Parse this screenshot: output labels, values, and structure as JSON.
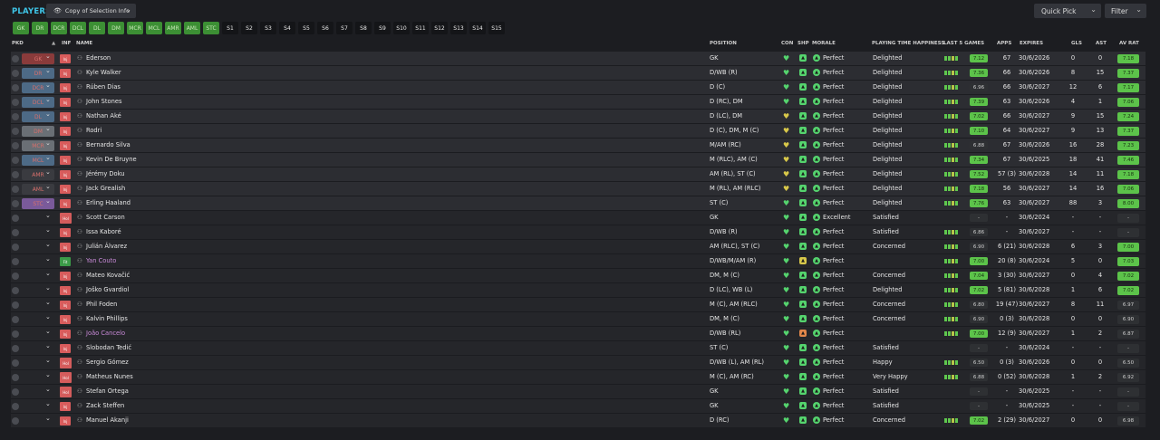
{
  "header": {
    "title": "PLAYERS",
    "view_label": "Copy of Selection Info",
    "quick_pick_label": "Quick Pick",
    "filter_label": "Filter"
  },
  "position_chips": [
    "GK",
    "DR",
    "DCR",
    "DCL",
    "DL",
    "DM",
    "MCR",
    "MCL",
    "AMR",
    "AML",
    "STC"
  ],
  "sub_chips": [
    "S1",
    "S2",
    "S3",
    "S4",
    "S5",
    "S6",
    "S7",
    "S8",
    "S9",
    "S10",
    "S11",
    "S12",
    "S13",
    "S14",
    "S15"
  ],
  "columns": {
    "pkd": "PKD",
    "inf": "INF",
    "name": "NAME",
    "position": "POSITION",
    "con": "CON",
    "shp": "SHP",
    "morale": "MORALE",
    "pth": "PLAYING TIME HAPPINESS",
    "last5": "LAST 5 GAMES",
    "apps": "APPS",
    "expires": "EXPIRES",
    "gls": "GLS",
    "ast": "AST",
    "avr": "AV RAT"
  },
  "colors": {
    "accent": "#3fc6e8",
    "good": "#5cc34a",
    "warn": "#d8c84a",
    "bad": "#d85c5c"
  },
  "players": [
    {
      "name": "Ederson",
      "pos_slot": "GK",
      "inf": "Inj",
      "position": "GK",
      "con": "green",
      "shp": "green",
      "morale": "Perfect",
      "pth": "Delighted",
      "form": "7.12",
      "apps": "67",
      "exp": "30/6/2026",
      "gls": "0",
      "ast": "0",
      "avr": "7.18",
      "avr_color": "g"
    },
    {
      "name": "Kyle Walker",
      "pos_slot": "DR",
      "inf": "Inj",
      "position": "D/WB (R)",
      "con": "green",
      "shp": "green",
      "morale": "Perfect",
      "pth": "Delighted",
      "form": "7.36",
      "apps": "66",
      "exp": "30/6/2026",
      "gls": "8",
      "ast": "15",
      "avr": "7.37",
      "avr_color": "g"
    },
    {
      "name": "Rúben Dias",
      "pos_slot": "DCR",
      "inf": "Inj",
      "position": "D (C)",
      "con": "green",
      "shp": "green",
      "morale": "Perfect",
      "pth": "Delighted",
      "form": "6.96",
      "apps": "66",
      "exp": "30/6/2027",
      "gls": "12",
      "ast": "6",
      "avr": "7.17",
      "avr_color": "g"
    },
    {
      "name": "John Stones",
      "pos_slot": "DCL",
      "inf": "Inj",
      "position": "D (RC), DM",
      "con": "green",
      "shp": "green",
      "morale": "Perfect",
      "pth": "Delighted",
      "form": "7.39",
      "apps": "63",
      "exp": "30/6/2026",
      "gls": "4",
      "ast": "1",
      "avr": "7.06",
      "avr_color": "g"
    },
    {
      "name": "Nathan Aké",
      "pos_slot": "DL",
      "inf": "Inj",
      "position": "D (LC), DM",
      "con": "yellow",
      "shp": "green",
      "morale": "Perfect",
      "pth": "Delighted",
      "form": "7.02",
      "apps": "66",
      "exp": "30/6/2027",
      "gls": "9",
      "ast": "15",
      "avr": "7.24",
      "avr_color": "g"
    },
    {
      "name": "Rodri",
      "pos_slot": "DM",
      "inf": "Inj",
      "position": "D (C), DM, M (C)",
      "con": "yellow",
      "shp": "green",
      "morale": "Perfect",
      "pth": "Delighted",
      "form": "7.10",
      "apps": "64",
      "exp": "30/6/2027",
      "gls": "9",
      "ast": "13",
      "avr": "7.37",
      "avr_color": "g"
    },
    {
      "name": "Bernardo Silva",
      "pos_slot": "MCR",
      "inf": "Inj",
      "position": "M/AM (RC)",
      "con": "yellow",
      "shp": "green",
      "morale": "Perfect",
      "pth": "Delighted",
      "form": "6.88",
      "apps": "67",
      "exp": "30/6/2026",
      "gls": "16",
      "ast": "28",
      "avr": "7.23",
      "avr_color": "g"
    },
    {
      "name": "Kevin De Bruyne",
      "pos_slot": "MCL",
      "inf": "Inj",
      "position": "M (RLC), AM (C)",
      "con": "yellow",
      "shp": "green",
      "morale": "Perfect",
      "pth": "Delighted",
      "form": "7.34",
      "apps": "67",
      "exp": "30/6/2025",
      "gls": "18",
      "ast": "41",
      "avr": "7.46",
      "avr_color": "g"
    },
    {
      "name": "Jérémy Doku",
      "pos_slot": "AMR",
      "inf": "Inj",
      "position": "AM (RL), ST (C)",
      "con": "yellow",
      "shp": "green",
      "morale": "Perfect",
      "pth": "Delighted",
      "form": "7.52",
      "apps": "57 (3)",
      "exp": "30/6/2028",
      "gls": "14",
      "ast": "11",
      "avr": "7.18",
      "avr_color": "g"
    },
    {
      "name": "Jack Grealish",
      "pos_slot": "AML",
      "inf": "Inj",
      "position": "M (RL), AM (RLC)",
      "con": "yellow",
      "shp": "green",
      "morale": "Perfect",
      "pth": "Delighted",
      "form": "7.18",
      "apps": "56",
      "exp": "30/6/2027",
      "gls": "14",
      "ast": "16",
      "avr": "7.06",
      "avr_color": "g"
    },
    {
      "name": "Erling Haaland",
      "pos_slot": "STC",
      "inf": "Inj",
      "position": "ST (C)",
      "con": "green",
      "shp": "green",
      "morale": "Perfect",
      "pth": "Delighted",
      "form": "7.76",
      "apps": "63",
      "exp": "30/6/2027",
      "gls": "88",
      "ast": "3",
      "avr": "8.00",
      "avr_color": "g"
    },
    {
      "name": "Scott Carson",
      "pos_slot": "",
      "inf": "Hol",
      "position": "GK",
      "con": "green",
      "shp": "green",
      "morale": "Excellent",
      "pth": "Satisfied",
      "form": "-",
      "apps": "-",
      "exp": "30/6/2024",
      "gls": "-",
      "ast": "-",
      "avr": "-",
      "avr_color": "d"
    },
    {
      "name": "Issa Kaboré",
      "pos_slot": "",
      "inf": "Inj",
      "position": "D/WB (R)",
      "con": "green",
      "shp": "green",
      "morale": "Perfect",
      "pth": "Satisfied",
      "form": "6.86",
      "apps": "-",
      "exp": "30/6/2027",
      "gls": "-",
      "ast": "-",
      "avr": "-",
      "avr_color": "d"
    },
    {
      "name": "Julián Álvarez",
      "pos_slot": "",
      "inf": "Inj",
      "position": "AM (RLC), ST (C)",
      "con": "green",
      "shp": "green",
      "morale": "Perfect",
      "pth": "Concerned",
      "form": "6.90",
      "apps": "6 (21)",
      "exp": "30/6/2028",
      "gls": "6",
      "ast": "3",
      "avr": "7.00",
      "avr_color": "g"
    },
    {
      "name": "Yan Couto",
      "pos_slot": "",
      "inf": "Fit",
      "position": "D/WB/M/AM (R)",
      "con": "green",
      "shp": "yellow",
      "morale": "Perfect",
      "pth": "",
      "form": "7.00",
      "apps": "20 (8)",
      "exp": "30/6/2024",
      "gls": "5",
      "ast": "0",
      "avr": "7.03",
      "avr_color": "g"
    },
    {
      "name": "Mateo Kovačić",
      "pos_slot": "",
      "inf": "Inj",
      "position": "DM, M (C)",
      "con": "green",
      "shp": "green",
      "morale": "Perfect",
      "pth": "Concerned",
      "form": "7.04",
      "apps": "3 (30)",
      "exp": "30/6/2027",
      "gls": "0",
      "ast": "4",
      "avr": "7.02",
      "avr_color": "g"
    },
    {
      "name": "Joško Gvardiol",
      "pos_slot": "",
      "inf": "Inj",
      "position": "D (LC), WB (L)",
      "con": "green",
      "shp": "green",
      "morale": "Perfect",
      "pth": "Delighted",
      "form": "7.02",
      "apps": "5 (81)",
      "exp": "30/6/2028",
      "gls": "1",
      "ast": "6",
      "avr": "7.02",
      "avr_color": "g"
    },
    {
      "name": "Phil Foden",
      "pos_slot": "",
      "inf": "Inj",
      "position": "M (C), AM (RLC)",
      "con": "green",
      "shp": "green",
      "morale": "Perfect",
      "pth": "Concerned",
      "form": "6.80",
      "apps": "19 (47)",
      "exp": "30/6/2027",
      "gls": "8",
      "ast": "11",
      "avr": "6.97",
      "avr_color": "d"
    },
    {
      "name": "Kalvin Phillips",
      "pos_slot": "",
      "inf": "Inj",
      "position": "DM, M (C)",
      "con": "green",
      "shp": "green",
      "morale": "Perfect",
      "pth": "Concerned",
      "form": "6.90",
      "apps": "0 (3)",
      "exp": "30/6/2028",
      "gls": "0",
      "ast": "0",
      "avr": "6.90",
      "avr_color": "d"
    },
    {
      "name": "João Cancelo",
      "pos_slot": "",
      "inf": "Inj",
      "position": "D/WB (RL)",
      "con": "green",
      "shp": "orange",
      "morale": "Perfect",
      "pth": "",
      "form": "7.00",
      "apps": "12 (9)",
      "exp": "30/6/2027",
      "gls": "1",
      "ast": "2",
      "avr": "6.87",
      "avr_color": "d"
    },
    {
      "name": "Slobodan Tedić",
      "pos_slot": "",
      "inf": "Inj",
      "position": "ST (C)",
      "con": "green",
      "shp": "green",
      "morale": "Perfect",
      "pth": "Satisfied",
      "form": "-",
      "apps": "-",
      "exp": "30/6/2024",
      "gls": "-",
      "ast": "-",
      "avr": "-",
      "avr_color": "d"
    },
    {
      "name": "Sergio Gómez",
      "pos_slot": "",
      "inf": "Hol",
      "position": "D/WB (L), AM (RL)",
      "con": "green",
      "shp": "green",
      "morale": "Perfect",
      "pth": "Happy",
      "form": "6.50",
      "apps": "0 (3)",
      "exp": "30/6/2026",
      "gls": "0",
      "ast": "0",
      "avr": "6.50",
      "avr_color": "d"
    },
    {
      "name": "Matheus Nunes",
      "pos_slot": "",
      "inf": "Hol",
      "position": "M (C), AM (RC)",
      "con": "green",
      "shp": "green",
      "morale": "Perfect",
      "pth": "Very Happy",
      "form": "6.88",
      "apps": "0 (52)",
      "exp": "30/6/2028",
      "gls": "1",
      "ast": "2",
      "avr": "6.92",
      "avr_color": "d"
    },
    {
      "name": "Stefan Ortega",
      "pos_slot": "",
      "inf": "Hol",
      "position": "GK",
      "con": "green",
      "shp": "green",
      "morale": "Perfect",
      "pth": "Satisfied",
      "form": "-",
      "apps": "-",
      "exp": "30/6/2025",
      "gls": "-",
      "ast": "-",
      "avr": "-",
      "avr_color": "d"
    },
    {
      "name": "Zack Steffen",
      "pos_slot": "",
      "inf": "Inj",
      "position": "GK",
      "con": "green",
      "shp": "green",
      "morale": "Perfect",
      "pth": "Satisfied",
      "form": "-",
      "apps": "-",
      "exp": "30/6/2025",
      "gls": "-",
      "ast": "-",
      "avr": "-",
      "avr_color": "d"
    },
    {
      "name": "Manuel Akanji",
      "pos_slot": "",
      "inf": "Inj",
      "position": "D (RC)",
      "con": "green",
      "shp": "green",
      "morale": "Perfect",
      "pth": "Concerned",
      "form": "7.02",
      "apps": "2 (29)",
      "exp": "30/6/2027",
      "gls": "0",
      "ast": "0",
      "avr": "6.98",
      "avr_color": "d"
    }
  ]
}
